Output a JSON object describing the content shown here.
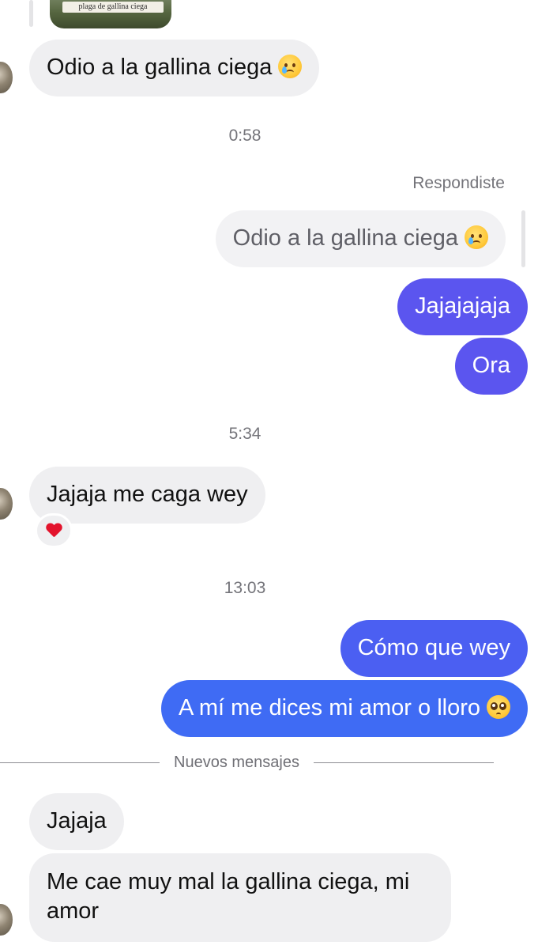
{
  "shared_post": {
    "caption": "plaga de gallina ciega"
  },
  "messages": {
    "m1": {
      "text": "Odio a la gallina ciega",
      "emoji": "crying-face"
    },
    "t1": "0:58",
    "replied_label": "Respondiste",
    "quoted": {
      "text": "Odio a la gallina ciega",
      "emoji": "crying-face"
    },
    "m2": "Jajajajaja",
    "m3": "Ora",
    "t2": "5:34",
    "m4": "Jajaja me caga wey",
    "m4_reaction": "heart",
    "t3": "13:03",
    "m5": "Cómo que wey",
    "m6": {
      "text": "A mí me dices mi amor o lloro",
      "emoji": "pleading-face"
    },
    "new_messages_label": "Nuevos mensajes",
    "m7": "Jajaja",
    "m8": "Me cae muy mal la gallina ciega, mi amor"
  },
  "colors": {
    "incoming_bubble": "#efeff1",
    "outgoing_purple": "#5b55ef",
    "outgoing_indigo": "#4b5ff2",
    "outgoing_blue": "#3f6bf4",
    "heart": "#e3132c"
  }
}
